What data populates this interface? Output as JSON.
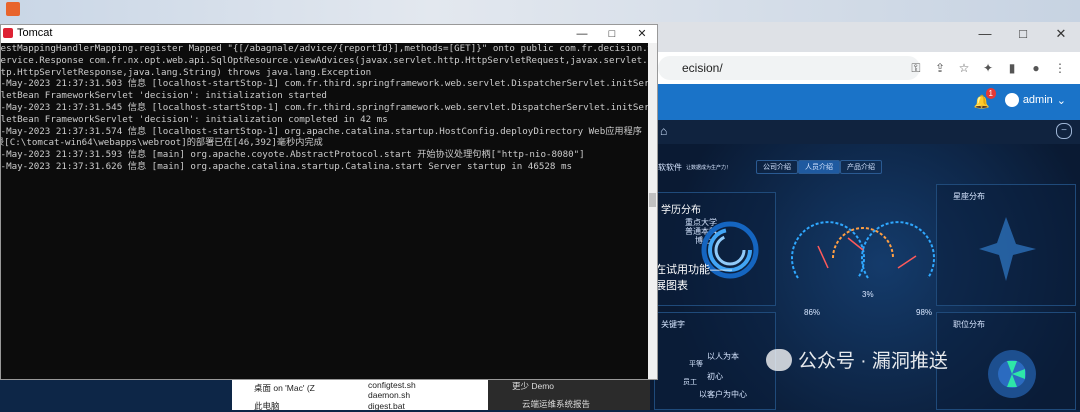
{
  "chrome": {
    "address": "ecision/",
    "window_controls": [
      "—",
      "□",
      "✕"
    ],
    "toolbar_icons": [
      "key-icon",
      "share-icon",
      "star-icon",
      "extensions-icon",
      "sidebar-icon",
      "profile-icon",
      "menu-icon"
    ]
  },
  "app": {
    "notification_count": "1",
    "user": "admin"
  },
  "dashboard": {
    "brand": "软软件",
    "subtitle": "让数据成为生产力！",
    "tabs": [
      "公司介绍",
      "人员介绍",
      "产品介绍"
    ],
    "edu_title": "学历分布",
    "edu_items": [
      "重点大学",
      "普通本科",
      "博士"
    ],
    "trial_text_1": "在试用功能——",
    "trial_text_2": "展图表",
    "star_title": "星座分布",
    "job_title": "职位分布",
    "keyword_title": "关键字",
    "keywords": [
      "以人为本",
      "平等",
      "初心",
      "员工",
      "以客户为中心"
    ],
    "gauge_values": [
      "86%",
      "3%",
      "98%"
    ]
  },
  "tomcat": {
    "title": "Tomcat",
    "controls": [
      "—",
      "□",
      "✕"
    ],
    "lines": [
      "uestMappingHandlerMapping.register Mapped \"{[/abagnale/advice/{reportId}],methods=[GET]}\" onto public com.fr.decision.we",
      "service.Response com.fr.nx.opt.web.api.SqlOptResource.viewAdvices(javax.servlet.http.HttpServletRequest,javax.servlet.h",
      "ttp.HttpServletResponse,java.lang.String) throws java.lang.Exception",
      "3-May-2023 21:37:31.503 信息 [localhost-startStop-1] com.fr.third.springframework.web.servlet.DispatcherServlet.initSer",
      "rletBean FrameworkServlet 'decision': initialization started",
      "3-May-2023 21:37:31.545 信息 [localhost-startStop-1] com.fr.third.springframework.web.servlet.DispatcherServlet.initSer",
      "rletBean FrameworkServlet 'decision': initialization completed in 42 ms",
      "3-May-2023 21:37:31.574 信息 [localhost-startStop-1] org.apache.catalina.startup.HostConfig.deployDirectory Web应用程序",
      "录[C:\\tomcat-win64\\webapps\\webroot]的部署已在[46,392]毫秒内完成",
      "3-May-2023 21:37:31.593 信息 [main] org.apache.coyote.AbstractProtocol.start 开始协议处理句柄[\"http-nio-8080\"]",
      "3-May-2023 21:37:31.626 信息 [main] org.apache.catalina.startup.Catalina.start Server startup in 46528 ms"
    ]
  },
  "taskbar": {
    "explorer_item_1": "桌面 on 'Mac' (Z",
    "explorer_item_2": "此电脑",
    "files": [
      "configtest.sh",
      "daemon.sh",
      "digest.bat"
    ],
    "dark_item_1": "更少 Demo",
    "dark_item_2": "云端运维系统报告"
  },
  "watermark": "公众号 · 漏洞推送"
}
